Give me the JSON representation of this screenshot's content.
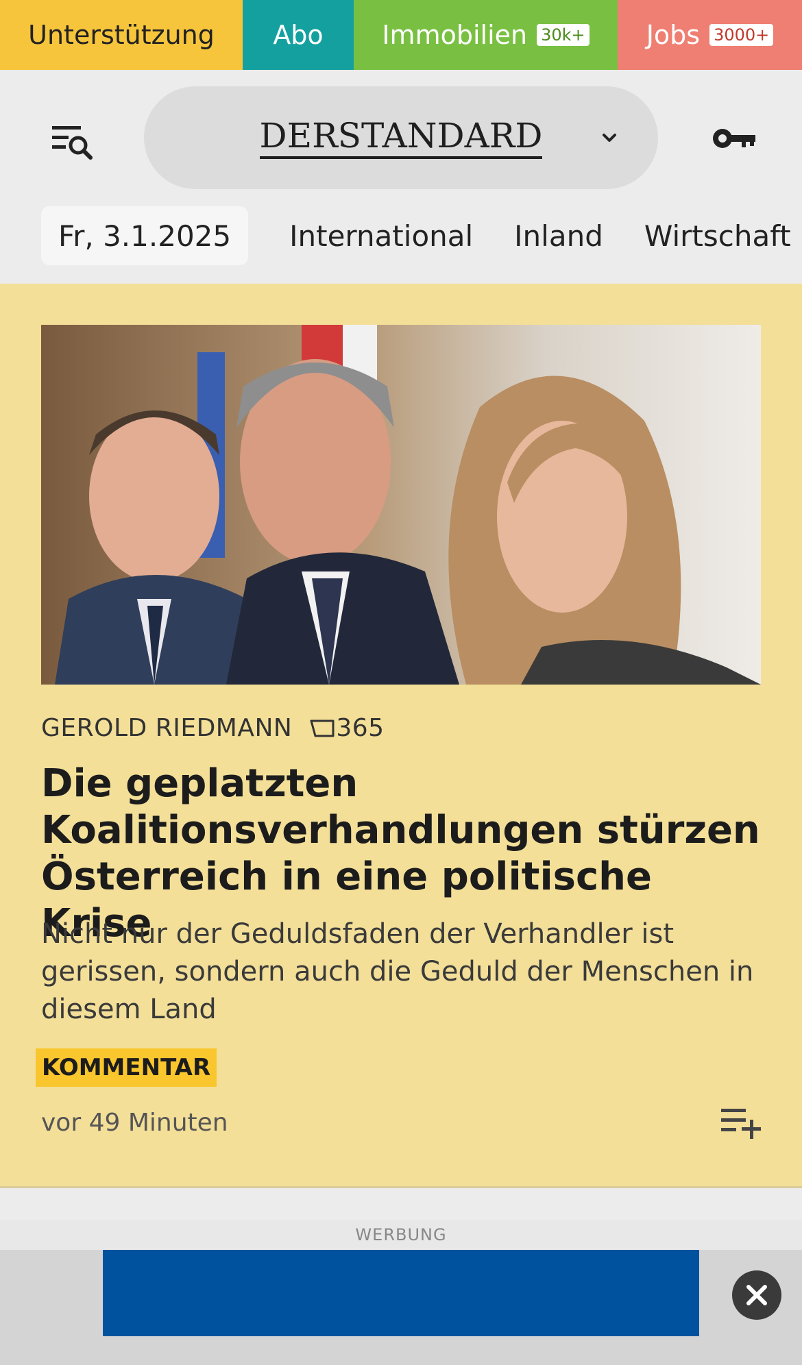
{
  "topbar": {
    "support": "Unterstützung",
    "abo": "Abo",
    "immobilien": "Immobilien",
    "immobilien_badge": "30k+",
    "jobs": "Jobs",
    "jobs_badge": "3000+"
  },
  "header": {
    "logo": "DERSTANDARD",
    "menu_icon": "menu-search-icon",
    "dropdown_icon": "chevron-down-icon",
    "login_icon": "key-icon"
  },
  "nav": {
    "date": "Fr, 3.1.2025",
    "items": [
      "International",
      "Inland",
      "Wirtschaft"
    ]
  },
  "article": {
    "author": "GEROLD RIEDMANN",
    "comment_count": "365",
    "headline": "Die geplatzten Koalitionsverhand­lungen stürzen Österreich in eine politische Krise",
    "lead": "Nicht nur der Geduldsfaden der Verhandler ist gerissen, sondern auch die Geduld der Menschen in diesem Land",
    "tag": "KOMMENTAR",
    "time_ago": "vor 49 Minuten",
    "colors": {
      "card_bg": "#f3df98",
      "tag_bg": "#f9c62e"
    }
  },
  "ad": {
    "label": "WERBUNG",
    "banner_color": "#00529e"
  }
}
